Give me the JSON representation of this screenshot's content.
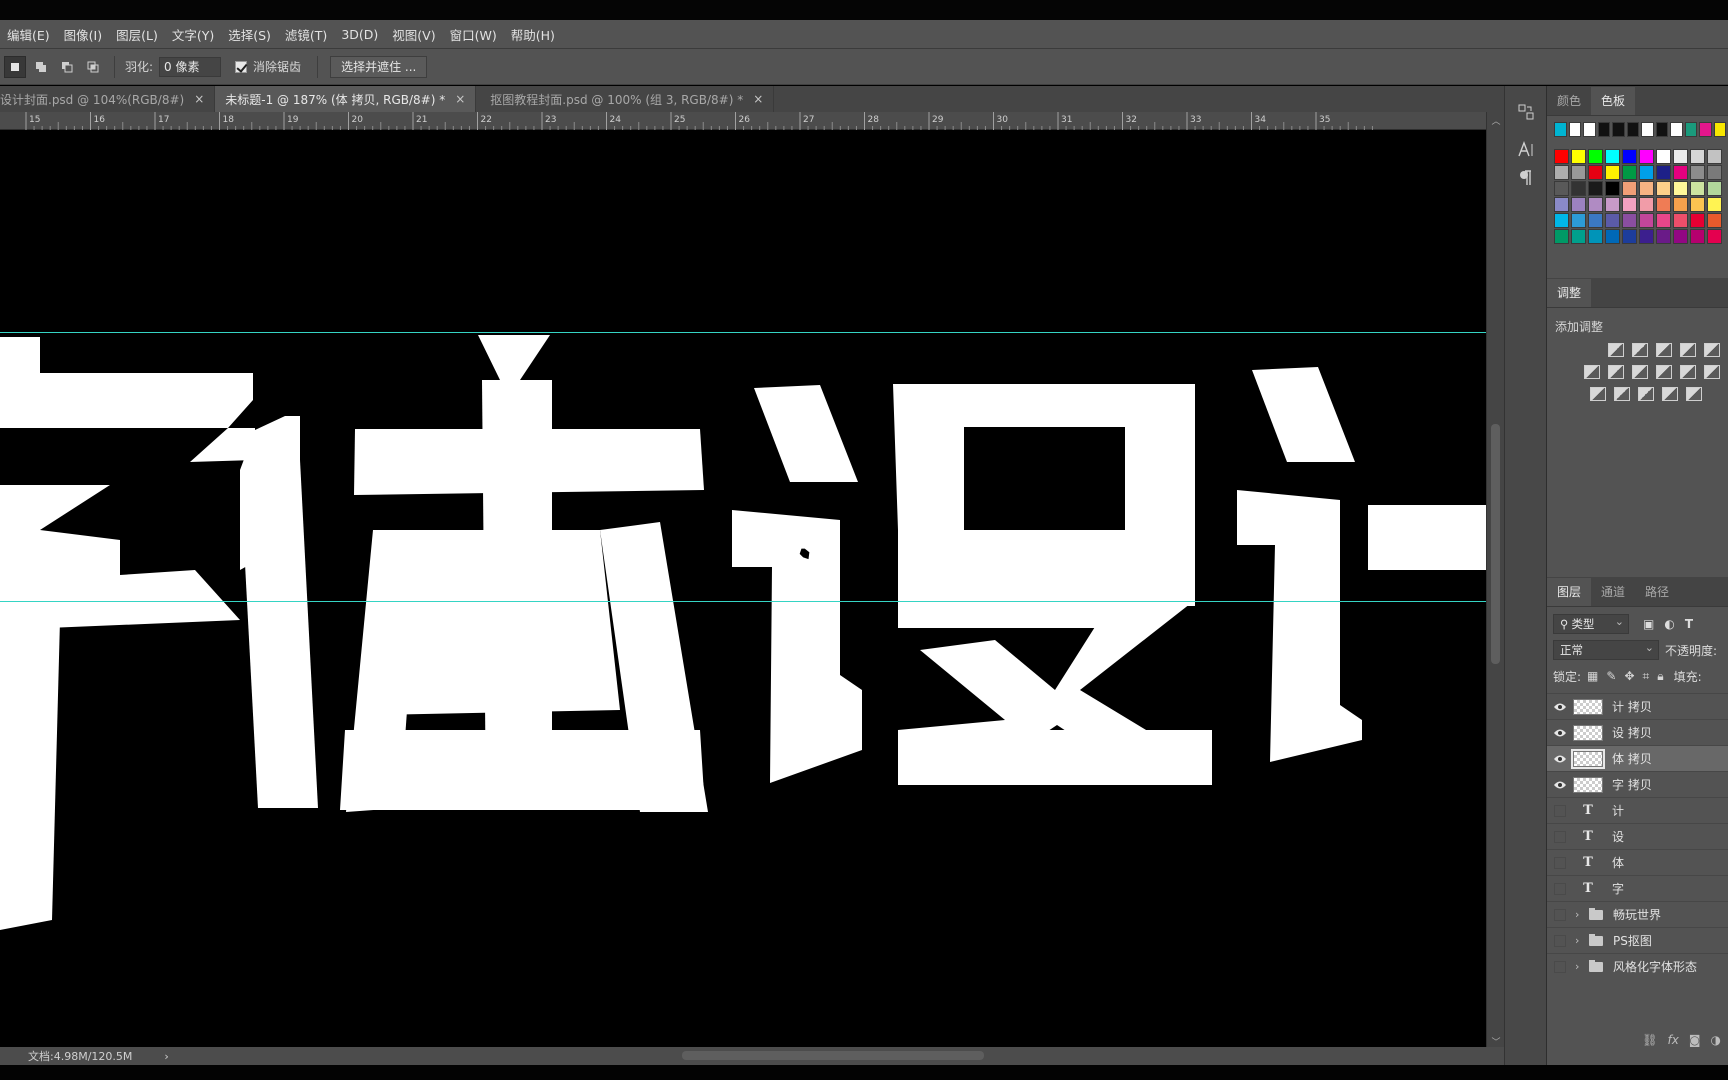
{
  "menu": [
    "编辑(E)",
    "图像(I)",
    "图层(L)",
    "文字(Y)",
    "选择(S)",
    "滤镜(T)",
    "3D(D)",
    "视图(V)",
    "窗口(W)",
    "帮助(H)"
  ],
  "options": {
    "feather_label": "羽化:",
    "feather_value": "0 像素",
    "antialias_label": "消除锯齿",
    "select_mask_button": "选择并遮住 ..."
  },
  "tabs": [
    {
      "label": "设计封面.psd @ 104%(RGB/8#)",
      "close": "×"
    },
    {
      "label": "未标题-1 @ 187% (体 拷贝, RGB/8#) *",
      "close": "×"
    },
    {
      "label": "抠图教程封面.psd @ 100% (组 3, RGB/8#) *",
      "close": "×"
    }
  ],
  "ruler_ticks": [
    "15",
    "16",
    "17",
    "18",
    "19",
    "20",
    "21",
    "22",
    "23",
    "24",
    "25",
    "26",
    "27",
    "28",
    "29",
    "30",
    "31",
    "32",
    "33",
    "34",
    "35"
  ],
  "status": {
    "doc": "文档:4.98M/120.5M",
    "arrow": "›"
  },
  "toolstrip_icons": [
    "history-icon",
    "character-icon",
    "paragraph-icon"
  ],
  "swatches_panel": {
    "tabs": [
      "颜色",
      "色板"
    ],
    "recent": [
      "#00b4d2",
      "#ffffff",
      "#ffffff",
      "#111111",
      "#111111",
      "#111111",
      "#ffffff",
      "#111111",
      "#ffffff",
      "#1a9a7c",
      "#e4168c",
      "#f7e600"
    ],
    "grid": [
      [
        "#ff0000",
        "#ffff00",
        "#00ff00",
        "#00ffff",
        "#0000ff",
        "#ff00ff",
        "#ffffff",
        "#ebebeb",
        "#d6d6d6",
        "#c2c2c2"
      ],
      [
        "#adadad",
        "#999999",
        "#e60012",
        "#fff100",
        "#009944",
        "#00a0e9",
        "#1d2088",
        "#e4007f",
        "#8c8c8c",
        "#7a7a7a"
      ],
      [
        "#595959",
        "#333333",
        "#1a1a1a",
        "#000000",
        "#f19e77",
        "#f6b383",
        "#fdd08a",
        "#fff799",
        "#cde3a0",
        "#b2d79b"
      ],
      [
        "#8a8ac8",
        "#9c82c0",
        "#b08bc3",
        "#c89ac8",
        "#f2a0c0",
        "#f19ca8",
        "#ef7c55",
        "#f5a04c",
        "#fbc451",
        "#fff352"
      ],
      [
        "#00b7e8",
        "#2c9bd6",
        "#3b78c2",
        "#5b5ba8",
        "#8a4ea0",
        "#c2469a",
        "#e8468a",
        "#ed4e6a",
        "#e60033",
        "#e85a2c"
      ],
      [
        "#009966",
        "#00a08c",
        "#0094b8",
        "#0068b7",
        "#1d3d9b",
        "#3c1f8e",
        "#6a1b88",
        "#920783",
        "#b5006e",
        "#e4004f"
      ]
    ]
  },
  "adjust_panel": {
    "tab": "调整",
    "title": "添加调整"
  },
  "layers_panel": {
    "tabs": [
      "图层",
      "通道",
      "路径"
    ],
    "filter_kind": "类型",
    "blend_mode": "正常",
    "opacity_label": "不透明度:",
    "lock_label": "锁定:",
    "fill_label": "填充:",
    "layers": [
      {
        "name": "计 拷贝",
        "kind": "raster",
        "visible": true,
        "selected": false
      },
      {
        "name": "设 拷贝",
        "kind": "raster",
        "visible": true,
        "selected": false
      },
      {
        "name": "体 拷贝",
        "kind": "raster",
        "visible": true,
        "selected": true
      },
      {
        "name": "字 拷贝",
        "kind": "raster",
        "visible": true,
        "selected": false
      },
      {
        "name": "计",
        "kind": "text",
        "visible": false,
        "selected": false
      },
      {
        "name": "设",
        "kind": "text",
        "visible": false,
        "selected": false
      },
      {
        "name": "体",
        "kind": "text",
        "visible": false,
        "selected": false
      },
      {
        "name": "字",
        "kind": "text",
        "visible": false,
        "selected": false
      },
      {
        "name": "畅玩世界",
        "kind": "group",
        "visible": false,
        "selected": false
      },
      {
        "name": "PS抠图",
        "kind": "group",
        "visible": false,
        "selected": false
      },
      {
        "name": "风格化字体形态",
        "kind": "group",
        "visible": false,
        "selected": false
      }
    ],
    "text_glyph": "T",
    "footer_icons": [
      "link-icon",
      "fx-icon",
      "mask-icon",
      "adjustment-icon"
    ],
    "footer_fx": "fx"
  },
  "colors": {
    "guide": "#35d4c4",
    "canvas": "#000000",
    "artwork": "#ffffff"
  }
}
